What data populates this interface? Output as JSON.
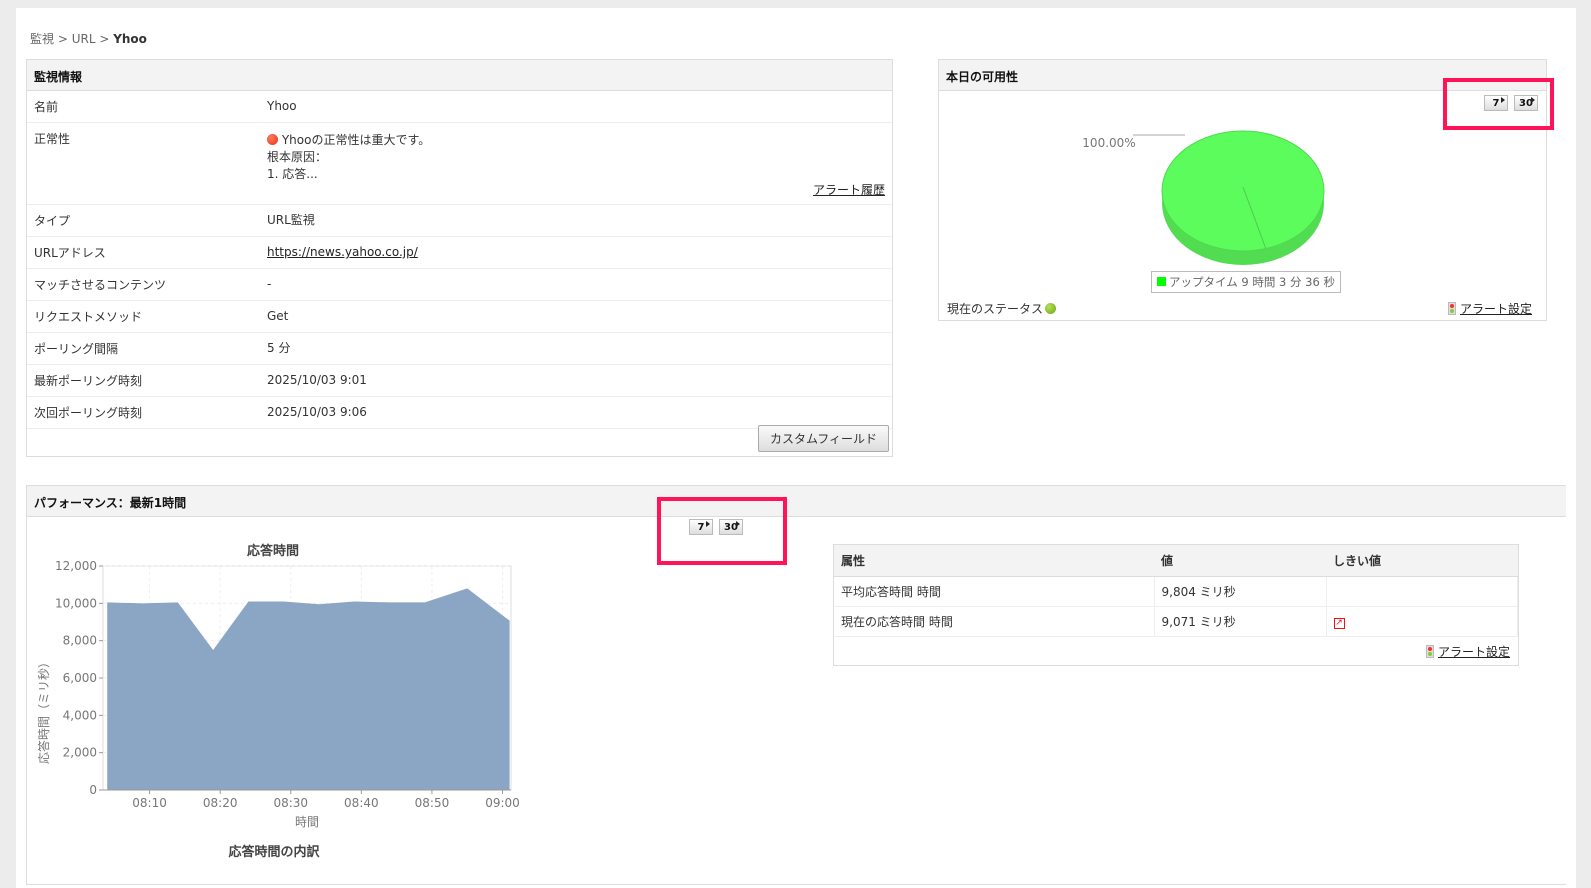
{
  "breadcrumb": {
    "root": "監視",
    "sep": " > ",
    "mid": "URL",
    "current": "Yhoo"
  },
  "monitor_info": {
    "title": "監視情報",
    "rows": [
      {
        "label": "名前",
        "value": "Yhoo"
      },
      {
        "label": "正常性",
        "value": "Yhooの正常性は重大です。",
        "line2": "根本原因：",
        "line3": "1. 応答...",
        "link": "アラート履歴"
      },
      {
        "label": "タイプ",
        "value": "URL監視"
      },
      {
        "label": "URLアドレス",
        "value": "https://news.yahoo.co.jp/"
      },
      {
        "label": "マッチさせるコンテンツ",
        "value": "-"
      },
      {
        "label": "リクエストメソッド",
        "value": "Get"
      },
      {
        "label": "ポーリング間隔",
        "value": "5 分"
      },
      {
        "label": "最新ポーリング時刻",
        "value": "2025/10/03 9:01"
      },
      {
        "label": "次回ポーリング時刻",
        "value": "2025/10/03 9:06"
      }
    ],
    "custom_field_button": "カスタムフィールド",
    "health_color": "#e8311a"
  },
  "availability": {
    "title": "本日の可用性",
    "btn7": "7",
    "btn30": "30",
    "pie_label": "100.00%",
    "legend": "アップタイム 9 時間 3 分 36 秒",
    "uptime_percent": 100,
    "status_label": "現在のステータス",
    "status_color": "#7dbb1a",
    "alert_settings": "アラート設定",
    "pie_color": "#5dfc5d"
  },
  "performance": {
    "title": "パフォーマンス：最新1時間",
    "btn7": "7",
    "btn30": "30",
    "breakdown_title": "応答時間の内訳",
    "table": {
      "headers": [
        "属性",
        "値",
        "しきい値"
      ],
      "rows": [
        {
          "attr": "平均応答時間 時間",
          "value": "9,804 ミリ秒",
          "threshold": ""
        },
        {
          "attr": "現在の応答時間 時間",
          "value": "9,071 ミリ秒",
          "threshold": "threshold-icon"
        }
      ],
      "alert_settings": "アラート設定"
    }
  },
  "chart_data": {
    "type": "area",
    "title": "応答時間",
    "xlabel": "時間",
    "ylabel": "応答時間（ミリ秒）",
    "ylim": [
      0,
      12000
    ],
    "yticks": [
      "0",
      "2,000",
      "4,000",
      "6,000",
      "8,000",
      "10,000",
      "12,000"
    ],
    "xticks": [
      "08:10",
      "08:20",
      "08:30",
      "08:40",
      "08:50",
      "09:00"
    ],
    "xlim_minutes": [
      483.4,
      541.2
    ],
    "x_minutes": [
      484,
      489,
      494,
      499,
      504,
      509,
      514,
      519,
      524,
      529,
      535,
      541
    ],
    "values": [
      10050,
      10000,
      10050,
      7500,
      10100,
      10100,
      9950,
      10100,
      10050,
      10050,
      10800,
      9071
    ],
    "color": "#8ba5c4",
    "grid": true
  }
}
